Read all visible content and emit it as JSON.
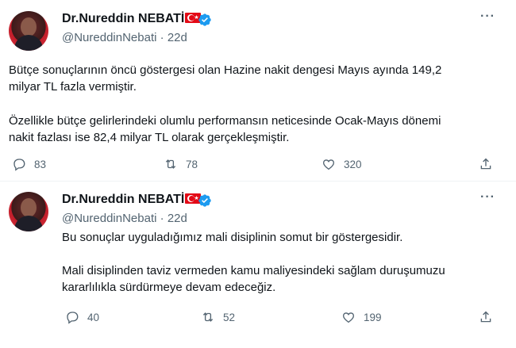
{
  "tweets": [
    {
      "author": {
        "display_name": "Dr.Nureddin NEBATİ",
        "handle": "@NureddinNebati",
        "age": "22d"
      },
      "paragraphs": [
        [
          "Bütçe sonuçlarının öncü göstergesi olan Hazine nakit dengesi Mayıs ayında 149,2",
          "milyar TL fazla vermiştir."
        ],
        [
          "Özellikle bütçe gelirlerindeki olumlu performansın neticesinde Ocak-Mayıs dönemi",
          "nakit fazlası ise 82,4 milyar TL olarak gerçekleşmiştir."
        ]
      ],
      "actions": {
        "replies": "83",
        "retweets": "78",
        "likes": "320"
      }
    },
    {
      "author": {
        "display_name": "Dr.Nureddin NEBATİ",
        "handle": "@NureddinNebati",
        "age": "22d"
      },
      "paragraphs": [
        [
          "Bu sonuçlar uyguladığımız mali disiplinin somut bir göstergesidir."
        ],
        [
          "Mali disiplinden taviz vermeden kamu maliyesindeki sağlam duruşumuzu",
          "kararlılıkla sürdürmeye devam edeceğiz."
        ]
      ],
      "actions": {
        "replies": "40",
        "retweets": "52",
        "likes": "199"
      }
    }
  ],
  "separator": "·",
  "icons": {
    "verified": "verified-badge-icon",
    "flag": "turkey-flag-icon",
    "reply": "reply-icon",
    "retweet": "retweet-icon",
    "like": "heart-icon",
    "share": "share-icon",
    "more": "more-options-icon"
  },
  "colors": {
    "verified": "#1d9bf0",
    "secondary_text": "#536471",
    "primary_text": "#0f1419"
  }
}
